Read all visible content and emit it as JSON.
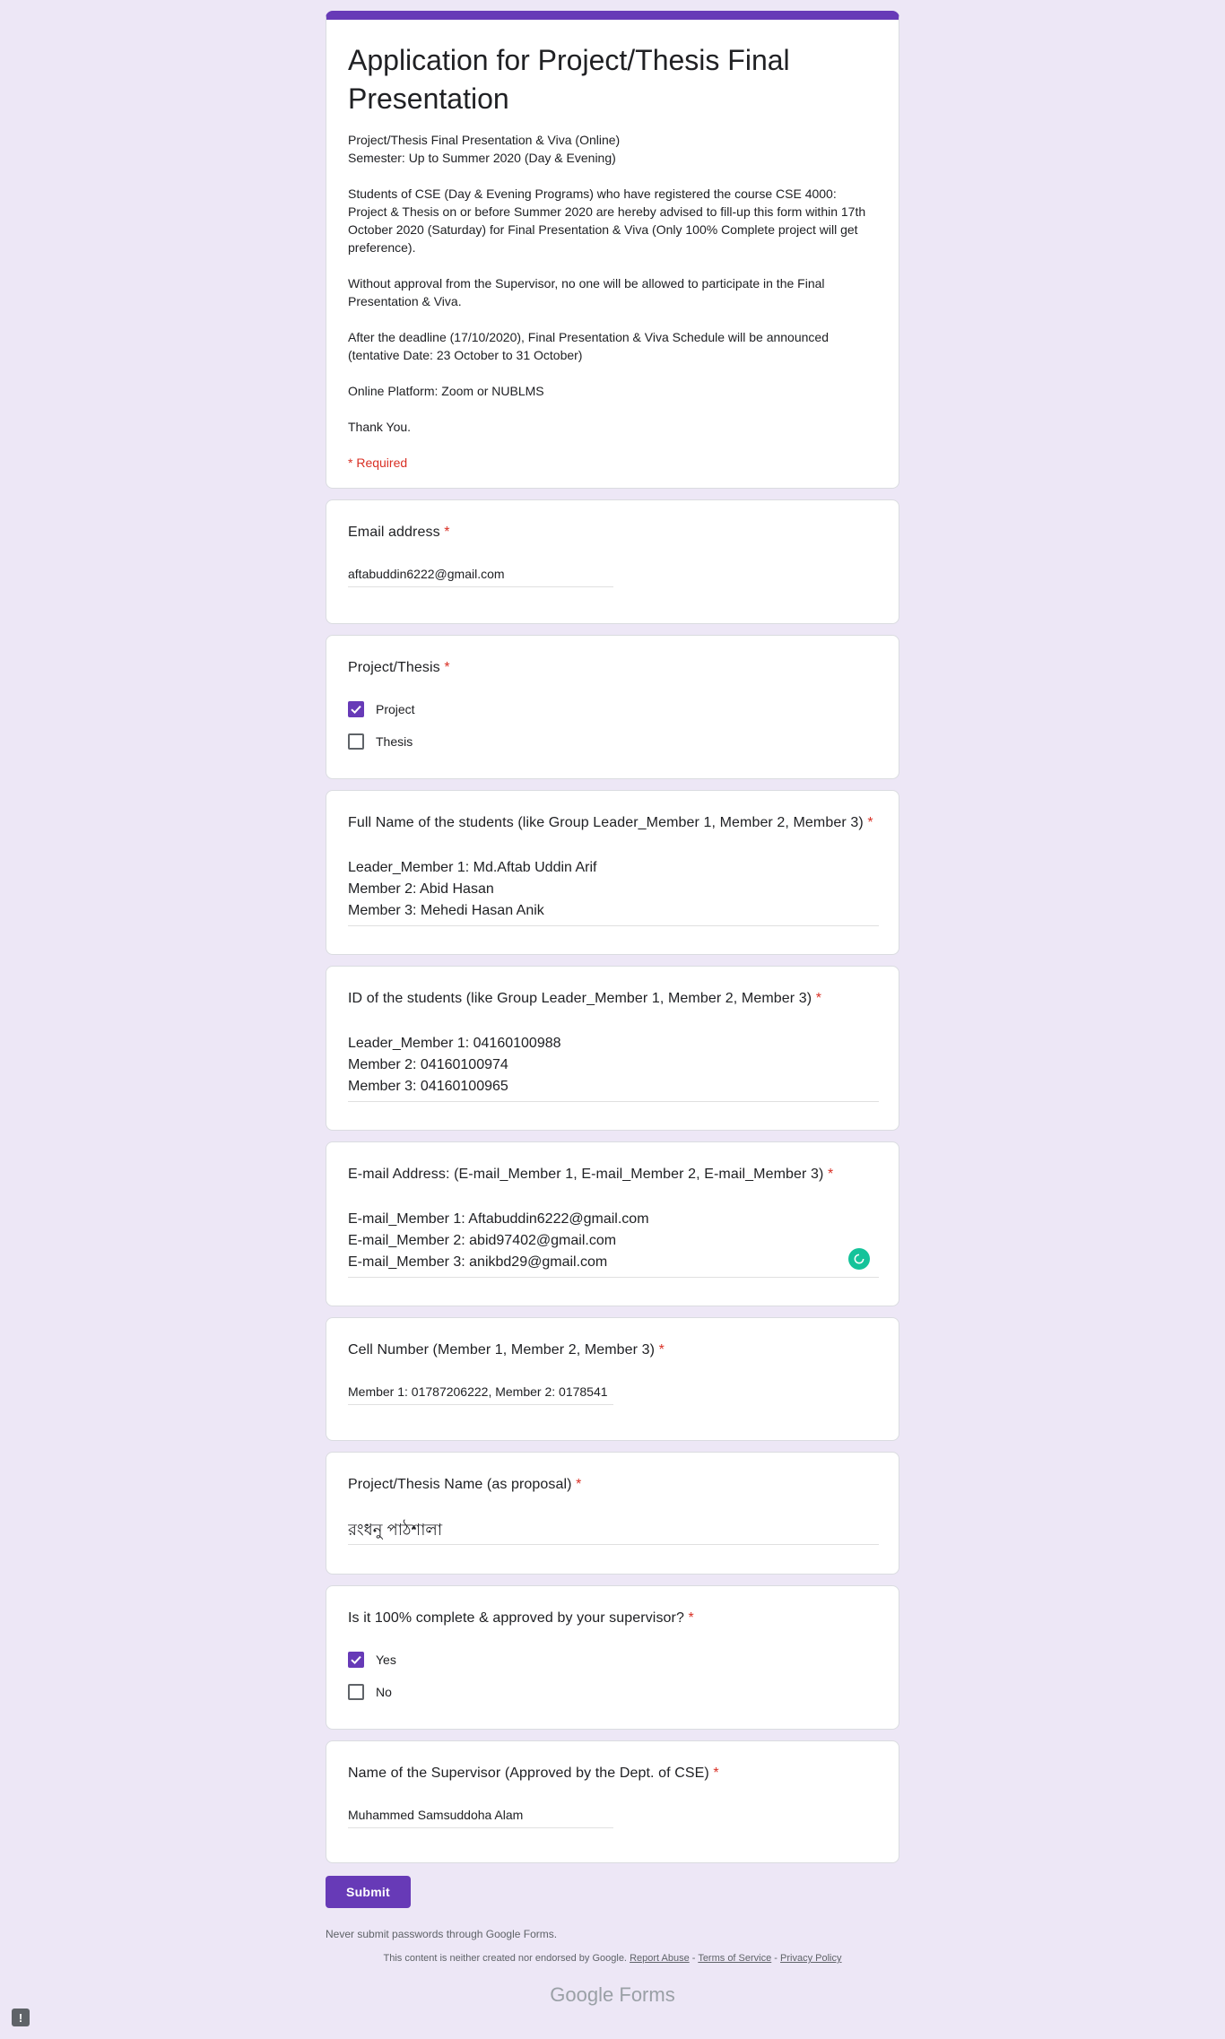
{
  "form": {
    "title": "Application for Project/Thesis Final Presentation",
    "description": "Project/Thesis Final Presentation & Viva (Online)\nSemester: Up to Summer 2020 (Day & Evening)\n\nStudents of CSE (Day & Evening Programs) who have registered the course CSE 4000: Project & Thesis on or before Summer 2020 are hereby advised to fill-up this form within 17th October 2020 (Saturday) for Final Presentation & Viva (Only 100% Complete project will get preference).\n\nWithout approval from the Supervisor, no one will be allowed to participate in the Final Presentation & Viva.\n\nAfter the deadline (17/10/2020), Final Presentation & Viva Schedule will be announced (tentative Date: 23 October to 31 October)\n\nOnline Platform: Zoom or NUBLMS\n\nThank You.",
    "required_note": "* Required"
  },
  "questions": {
    "email": {
      "label": "Email address",
      "star": "*",
      "value": "aftabuddin6222@gmail.com"
    },
    "type": {
      "label": "Project/Thesis",
      "star": "*",
      "options": [
        {
          "label": "Project",
          "checked": true
        },
        {
          "label": "Thesis",
          "checked": false
        }
      ]
    },
    "names": {
      "label": "Full Name of the students (like Group Leader_Member 1, Member 2, Member 3)",
      "star": "*",
      "value": "Leader_Member 1: Md.Aftab Uddin Arif\nMember 2: Abid Hasan\nMember 3: Mehedi Hasan Anik"
    },
    "ids": {
      "label": "ID of the students (like Group Leader_Member 1, Member 2, Member 3)",
      "star": "*",
      "value": "Leader_Member 1: 04160100988\nMember 2: 04160100974\nMember 3: 04160100965"
    },
    "emails": {
      "label": "E-mail Address: (E-mail_Member 1, E-mail_Member 2, E-mail_Member 3)",
      "star": "*",
      "value": "E-mail_Member 1: Aftabuddin6222@gmail.com\nE-mail_Member 2: abid97402@gmail.com\nE-mail_Member 3: anikbd29@gmail.com"
    },
    "cell": {
      "label": "Cell Number (Member 1, Member 2, Member 3)",
      "star": "*",
      "value": "Member 1: 01787206222, Member 2: 0178541"
    },
    "proj_name": {
      "label": "Project/Thesis Name (as proposal)",
      "star": "*",
      "value": "রংধনু পাঠশালা"
    },
    "complete": {
      "label": "Is it 100% complete & approved by your supervisor?",
      "star": "*",
      "options": [
        {
          "label": "Yes",
          "checked": true
        },
        {
          "label": "No",
          "checked": false
        }
      ]
    },
    "supervisor": {
      "label": "Name of the Supervisor (Approved by the Dept. of CSE)",
      "star": "*",
      "value": "Muhammed Samsuddoha Alam"
    }
  },
  "footer": {
    "submit_label": "Submit",
    "never_submit": "Never submit passwords through Google Forms.",
    "disclaimer_prefix": "This content is neither created nor endorsed by Google.",
    "report_abuse": "Report Abuse",
    "sep": "-",
    "terms": "Terms of Service",
    "privacy": "Privacy Policy",
    "brand_google": "Google",
    "brand_forms": "Forms"
  },
  "icons": {
    "checkbox_check": "check-icon",
    "grammarly": "grammarly-icon",
    "feedback": "feedback-icon"
  },
  "colors": {
    "accent": "#673ab7",
    "background": "#ede7f6",
    "required": "#d93025"
  }
}
